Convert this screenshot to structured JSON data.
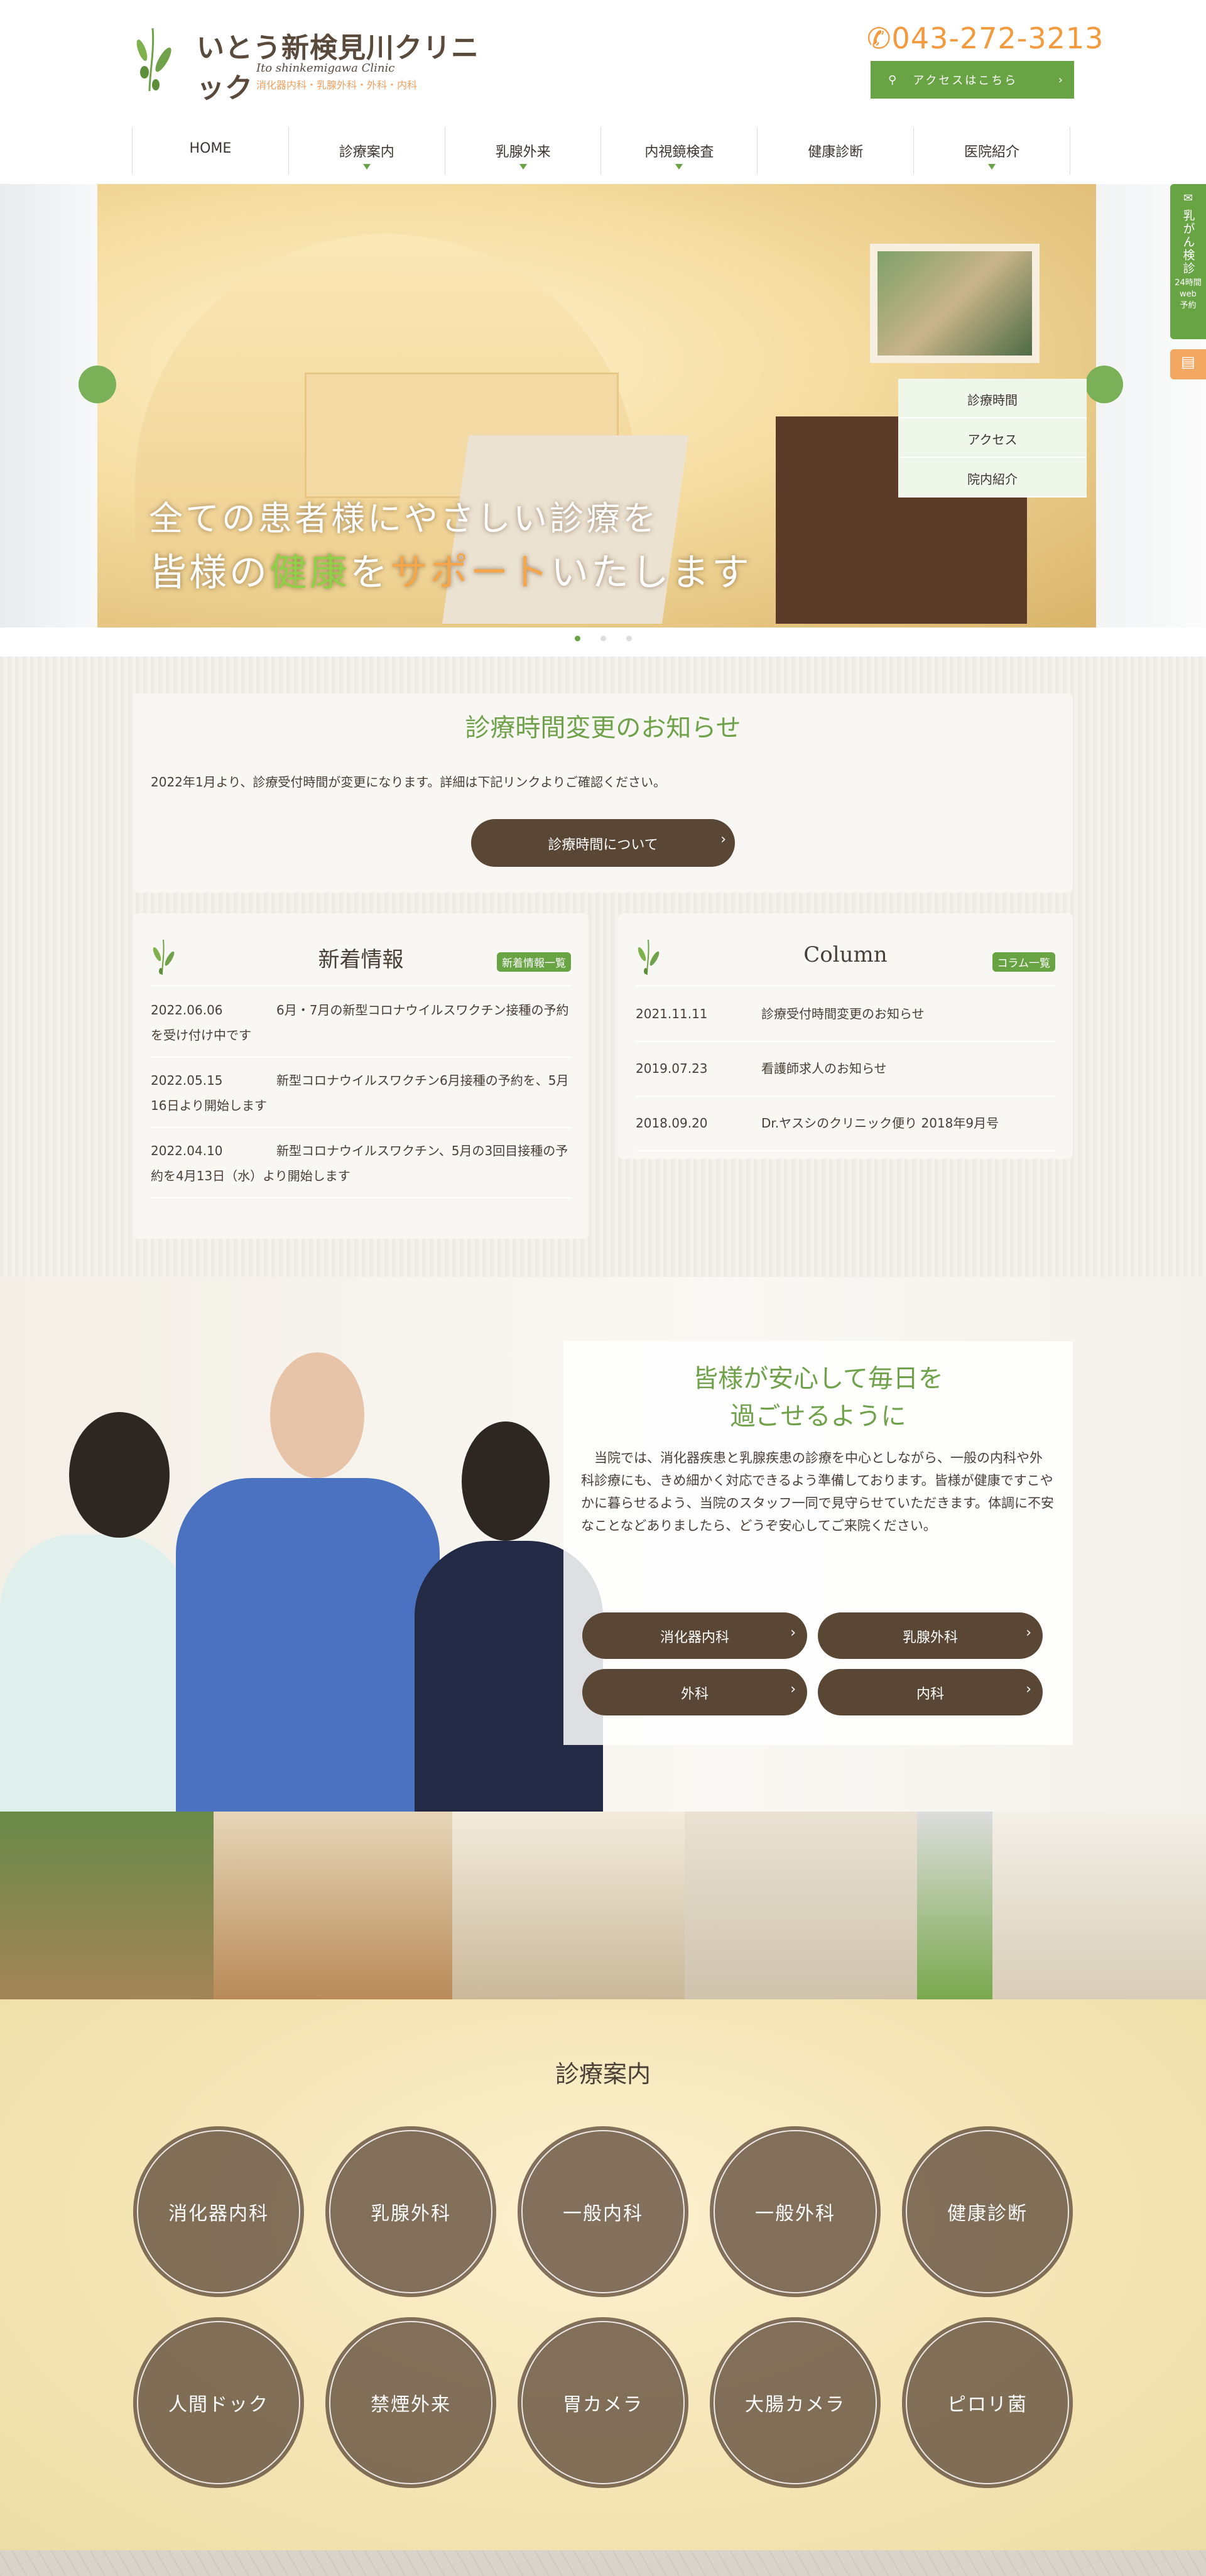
{
  "header": {
    "logo": {
      "name": "いとう新検見川クリニック",
      "en": "Ito shinkemigawa Clinic",
      "departments": "消化器内科・乳腺外科・外科・内科"
    },
    "phone": "043-272-3213",
    "access_label": "アクセスはこちら"
  },
  "nav": [
    {
      "label": "HOME",
      "has_submenu": false
    },
    {
      "label": "診療案内",
      "has_submenu": true
    },
    {
      "label": "乳腺外来",
      "has_submenu": true
    },
    {
      "label": "内視鏡検査",
      "has_submenu": true
    },
    {
      "label": "健康診断",
      "has_submenu": false
    },
    {
      "label": "医院紹介",
      "has_submenu": true
    }
  ],
  "submenu": [
    "診療時間",
    "アクセス",
    "院内紹介"
  ],
  "hero": {
    "line1": "全ての患者様にやさしい診療を",
    "line2_a": "皆様の",
    "line2_b": "健康",
    "line2_c": "を",
    "line2_d": "サポート",
    "line2_e": "いたします",
    "slide_count": 3,
    "active_slide": 1
  },
  "side_tabs": {
    "green_title": "乳がん検診",
    "green_sub1": "24時間",
    "green_sub2": "web",
    "green_sub3": "予約",
    "orange_icon": "clipboard-icon"
  },
  "notice": {
    "title": "診療時間変更のお知らせ",
    "body": "2022年1月より、診療受付時間が変更になります。詳細は下記リンクよりご確認ください。",
    "button": "診療時間について"
  },
  "news": {
    "title": "新着情報",
    "badge": "新着情報一覧",
    "items": [
      {
        "date": "2022.06.06",
        "text": "6月・7月の新型コロナウイルスワクチン接種の予約を受け付け中です"
      },
      {
        "date": "2022.05.15",
        "text": "新型コロナウイルスワクチン6月接種の予約を、5月16日より開始します"
      },
      {
        "date": "2022.04.10",
        "text": "新型コロナウイルスワクチン、5月の3回目接種の予約を4月13日（水）より開始します"
      }
    ]
  },
  "column": {
    "title": "Column",
    "badge": "コラム一覧",
    "items": [
      {
        "date": "2021.11.11",
        "text": "診療受付時間変更のお知らせ"
      },
      {
        "date": "2019.07.23",
        "text": "看護師求人のお知らせ"
      },
      {
        "date": "2018.09.20",
        "text": "Dr.ヤスシのクリニック便り 2018年9月号"
      }
    ]
  },
  "about": {
    "title1": "皆様が安心して毎日を",
    "title2": "過ごせるように",
    "body": "当院では、消化器疾患と乳腺疾患の診療を中心としながら、一般の内科や外科診療にも、きめ細かく対応できるよう準備しております。皆様が健康ですこやかに暮らせるよう、当院のスタッフ一同で見守らせていただきます。体調に不安なことなどありましたら、どうぞ安心してご来院ください。",
    "buttons": [
      "消化器内科",
      "乳腺外科",
      "外科",
      "内科"
    ]
  },
  "services": {
    "title": "診療案内",
    "items": [
      "消化器内科",
      "乳腺外科",
      "一般内科",
      "一般外科",
      "健康診断",
      "人間ドック",
      "禁煙外来",
      "胃カメラ",
      "大腸カメラ",
      "ピロリ菌"
    ]
  },
  "colors": {
    "brand_green": "#68a344",
    "accent_orange": "#f39a3e",
    "button_brown": "#5a4634"
  }
}
